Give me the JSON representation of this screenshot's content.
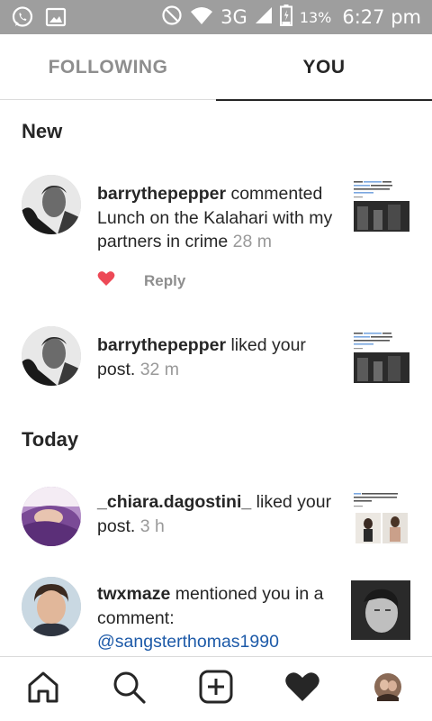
{
  "status_bar": {
    "network": "3G",
    "battery_percent": "13%",
    "time": "6:27 pm",
    "icons": [
      "whatsapp-icon",
      "gallery-icon",
      "do-not-disturb-icon",
      "wifi-icon",
      "signal-icon",
      "battery-icon"
    ]
  },
  "tabs": [
    {
      "label": "FOLLOWING",
      "active": false
    },
    {
      "label": "YOU",
      "active": true
    }
  ],
  "sections": {
    "new": "New",
    "today": "Today"
  },
  "notifications": [
    {
      "user": "barrythepepper",
      "action": " commented ",
      "body": "Lunch on the Kalahari with my partners in crime",
      "time": " 28 m",
      "thumb_title": "Happy Birthday to @BarryPepper aka Wille, Leader of the Night Aim! #TheDeathCure"
    },
    {
      "user": "barrythepepper",
      "action": " liked your post.",
      "time": " 32 m"
    },
    {
      "user": "_chiara.dagostini_",
      "action": " liked your post.",
      "time": " 3 h"
    },
    {
      "user": "twxmaze",
      "action": " mentioned you in a comment: ",
      "mention": "@sangsterthomas1990"
    }
  ],
  "reply": {
    "label": "Reply"
  },
  "colors": {
    "status_bar": "#9e9e9e",
    "heart": "#ed4956",
    "mention": "#1d5aa8",
    "muted": "#8e8e8e"
  },
  "bottom_nav": [
    "home-icon",
    "search-icon",
    "add-post-icon",
    "activity-heart-icon",
    "profile-avatar"
  ]
}
